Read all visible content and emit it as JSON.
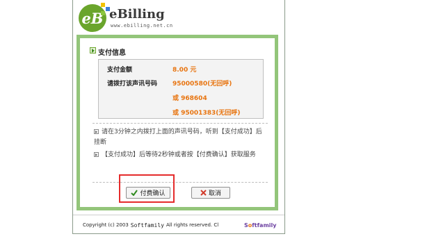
{
  "logo": {
    "mark": "eB",
    "name": "eBilling",
    "url": "www.ebilling.net.cn",
    "colors": {
      "circle": "#6aa52c",
      "square_yellow": "#f2c200",
      "square_blue": "#3b7dd8",
      "square_green": "#8cc63f"
    }
  },
  "section": {
    "title": "支付信息"
  },
  "payment": {
    "amount_label": "支付金额",
    "amount_value": "8.00 元",
    "phone_label": "请拨打该声讯号码",
    "phones": [
      "95000580(无回呼)",
      "或 968604",
      "或 95001383(无回呼)"
    ]
  },
  "notes": [
    "请在3分钟之内拨打上面的声讯号码，听到【支付成功】后挂断",
    "【支付成功】后等待2秒钟或者按【付费确认】获取服务"
  ],
  "buttons": {
    "confirm": "付费确认",
    "cancel": "取消"
  },
  "footer": {
    "prefix": "Copyright (c) 2003",
    "brand": "Softfamily",
    "suffix": "All rights reserved. Cl",
    "logo_left": "S",
    "logo_o": "o",
    "logo_right": "ftfamily"
  },
  "colors": {
    "frame_green": "#93c57a",
    "amount_orange": "#e8740f",
    "highlight_red": "#e52b2b"
  }
}
